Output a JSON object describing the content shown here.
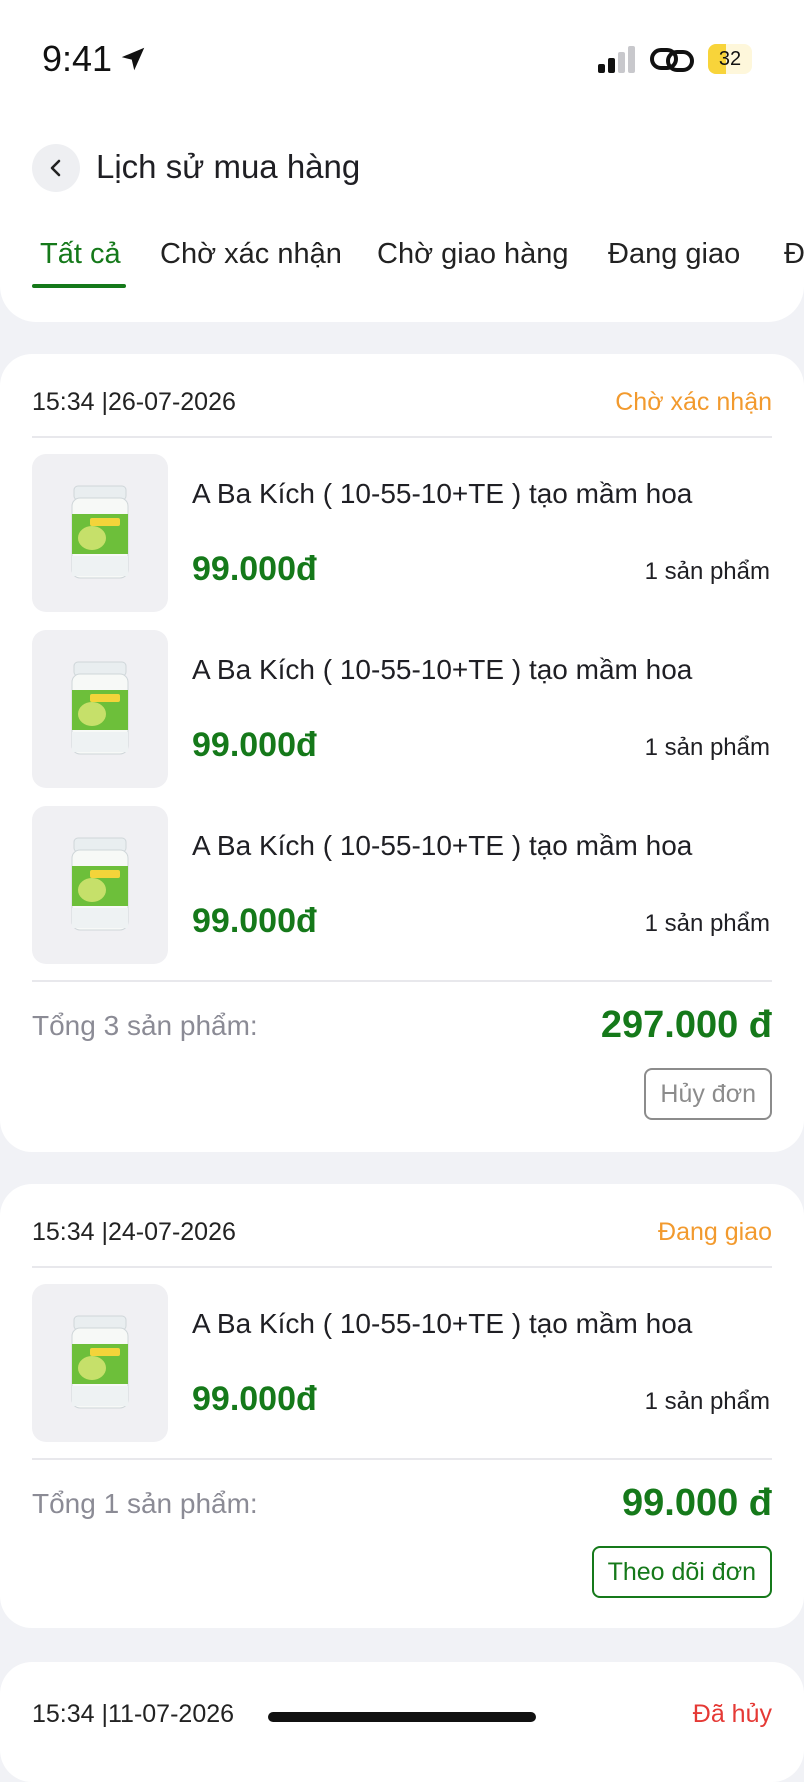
{
  "status_bar": {
    "time": "9:41",
    "battery": "32"
  },
  "header": {
    "title": "Lịch sử mua hàng"
  },
  "tabs": [
    {
      "label": "Tất cả"
    },
    {
      "label": "Chờ xác nhận"
    },
    {
      "label": "Chờ giao hàng"
    },
    {
      "label": "Đang giao"
    },
    {
      "label": "Đ"
    }
  ],
  "colors": {
    "accent_green": "#15791a",
    "status_pending": "#f29a2e",
    "status_cancelled": "#e53935",
    "muted": "#8b8b95"
  },
  "orders": [
    {
      "datetime": "15:34 |26-07-2026",
      "status": "Chờ xác nhận",
      "items": [
        {
          "name": "A Ba Kích ( 10-55-10+TE ) tạo mầm hoa",
          "price": "99.000đ",
          "qty": "1 sản phẩm"
        },
        {
          "name": "A Ba Kích ( 10-55-10+TE ) tạo mầm hoa",
          "price": "99.000đ",
          "qty": "1 sản phẩm"
        },
        {
          "name": "A Ba Kích ( 10-55-10+TE ) tạo mầm hoa",
          "price": "99.000đ",
          "qty": "1 sản phẩm"
        }
      ],
      "total_label": "Tổng 3 sản phẩm:",
      "total_value": "297.000 đ",
      "action_label": "Hủy đơn"
    },
    {
      "datetime": "15:34 |24-07-2026",
      "status": "Đang giao",
      "items": [
        {
          "name": "A Ba Kích ( 10-55-10+TE ) tạo mầm hoa",
          "price": "99.000đ",
          "qty": "1 sản phẩm"
        }
      ],
      "total_label": "Tổng 1 sản phẩm:",
      "total_value": "99.000 đ",
      "action_label": "Theo dõi đơn"
    },
    {
      "datetime": "15:34 |11-07-2026",
      "status": "Đã hủy"
    }
  ]
}
